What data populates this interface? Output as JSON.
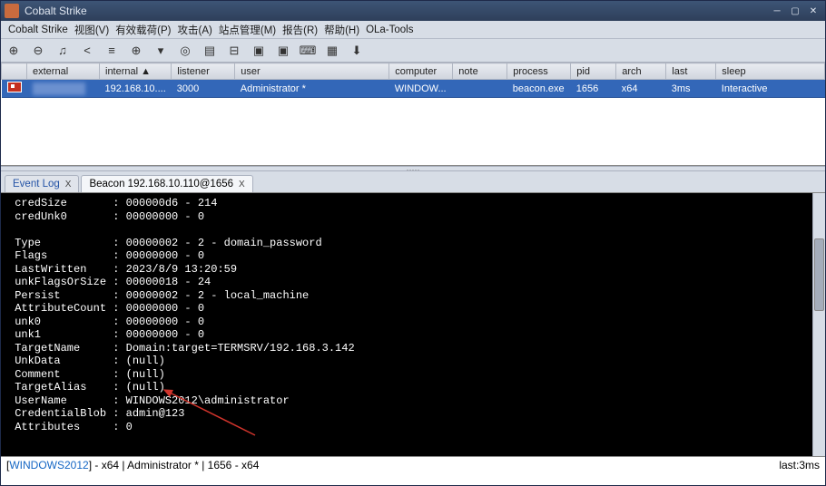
{
  "window": {
    "title": "Cobalt Strike"
  },
  "menu": {
    "items": [
      "Cobalt Strike",
      "视图(V)",
      "有效载荷(P)",
      "攻击(A)",
      "站点管理(M)",
      "报告(R)",
      "帮助(H)",
      "OLa-Tools"
    ]
  },
  "toolbar": {
    "icons": [
      "plus-circle-icon",
      "link-icon",
      "headphones-icon",
      "share-icon",
      "list-icon",
      "globe-icon",
      "dropdown-icon",
      "target-icon",
      "document-icon",
      "bars-icon",
      "computer-icon",
      "camera-icon",
      "keyboard-icon",
      "grid-icon",
      "download-icon"
    ]
  },
  "table": {
    "headers": [
      "",
      "external",
      "internal ▲",
      "listener",
      "user",
      "computer",
      "note",
      "process",
      "pid",
      "arch",
      "last",
      "sleep"
    ],
    "row": {
      "external": "",
      "internal": "192.168.10....",
      "listener": "3000",
      "user": "Administrator *",
      "computer": "WINDOW...",
      "note": "",
      "process": "beacon.exe",
      "pid": "1656",
      "arch": "x64",
      "last": "3ms",
      "sleep": "Interactive"
    }
  },
  "tabs": {
    "t1": "Event Log",
    "t2": "Beacon 192.168.10.110@1656"
  },
  "console": {
    "lines": [
      [
        "credSize",
        "000000d6 - 214"
      ],
      [
        "credUnk0",
        "00000000 - 0"
      ],
      [
        "",
        ""
      ],
      [
        "Type",
        "00000002 - 2 - domain_password"
      ],
      [
        "Flags",
        "00000000 - 0"
      ],
      [
        "LastWritten",
        "2023/8/9 13:20:59"
      ],
      [
        "unkFlagsOrSize",
        "00000018 - 24"
      ],
      [
        "Persist",
        "00000002 - 2 - local_machine"
      ],
      [
        "AttributeCount",
        "00000000 - 0"
      ],
      [
        "unk0",
        "00000000 - 0"
      ],
      [
        "unk1",
        "00000000 - 0"
      ],
      [
        "TargetName",
        "Domain:target=TERMSRV/192.168.3.142"
      ],
      [
        "UnkData",
        "(null)"
      ],
      [
        "Comment",
        "(null)"
      ],
      [
        "TargetAlias",
        "(null)"
      ],
      [
        "UserName",
        "WINDOWS2012\\administrator"
      ],
      [
        "CredentialBlob",
        "admin@123"
      ],
      [
        "Attributes",
        "0"
      ]
    ]
  },
  "status": {
    "host": "WINDOWS2012",
    "mid": " - x64 |  Administrator * | 1656 - x64",
    "right": "last:3ms"
  }
}
